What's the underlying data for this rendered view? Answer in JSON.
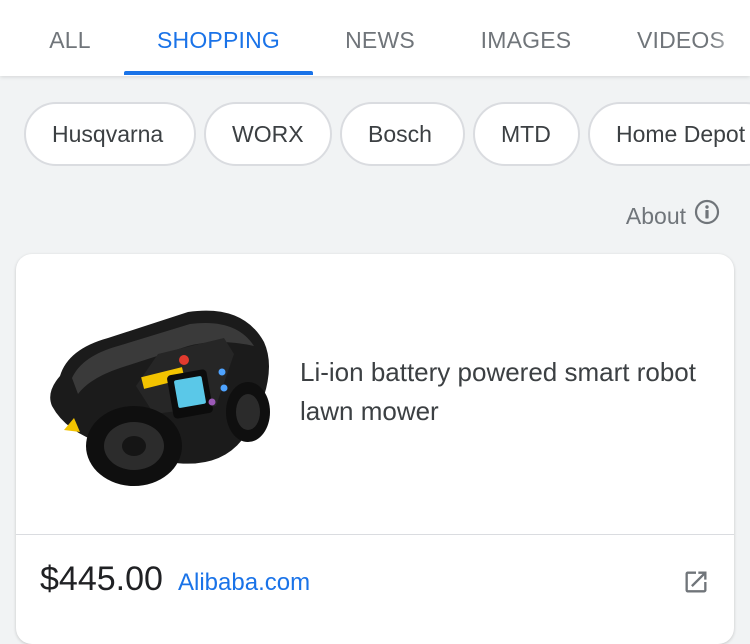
{
  "tabs": [
    {
      "label": "ALL",
      "active": false
    },
    {
      "label": "SHOPPING",
      "active": true
    },
    {
      "label": "NEWS",
      "active": false
    },
    {
      "label": "IMAGES",
      "active": false
    },
    {
      "label": "VIDEOS",
      "active": false
    }
  ],
  "filters": [
    "Husqvarna",
    "WORX",
    "Bosch",
    "MTD",
    "Home Depot"
  ],
  "about": {
    "label": "About",
    "icon": "info-icon"
  },
  "product": {
    "image": "robot-lawn-mower-image",
    "title": "Li-ion battery powered smart robot lawn mower",
    "price": "$445.00",
    "merchant": "Alibaba.com",
    "open_icon": "open-in-new-icon"
  },
  "colors": {
    "accent": "#1a73e8",
    "text_secondary": "#70757a",
    "text_primary": "#202124",
    "chip_border": "#dadce0",
    "page_background": "#f1f3f4"
  }
}
